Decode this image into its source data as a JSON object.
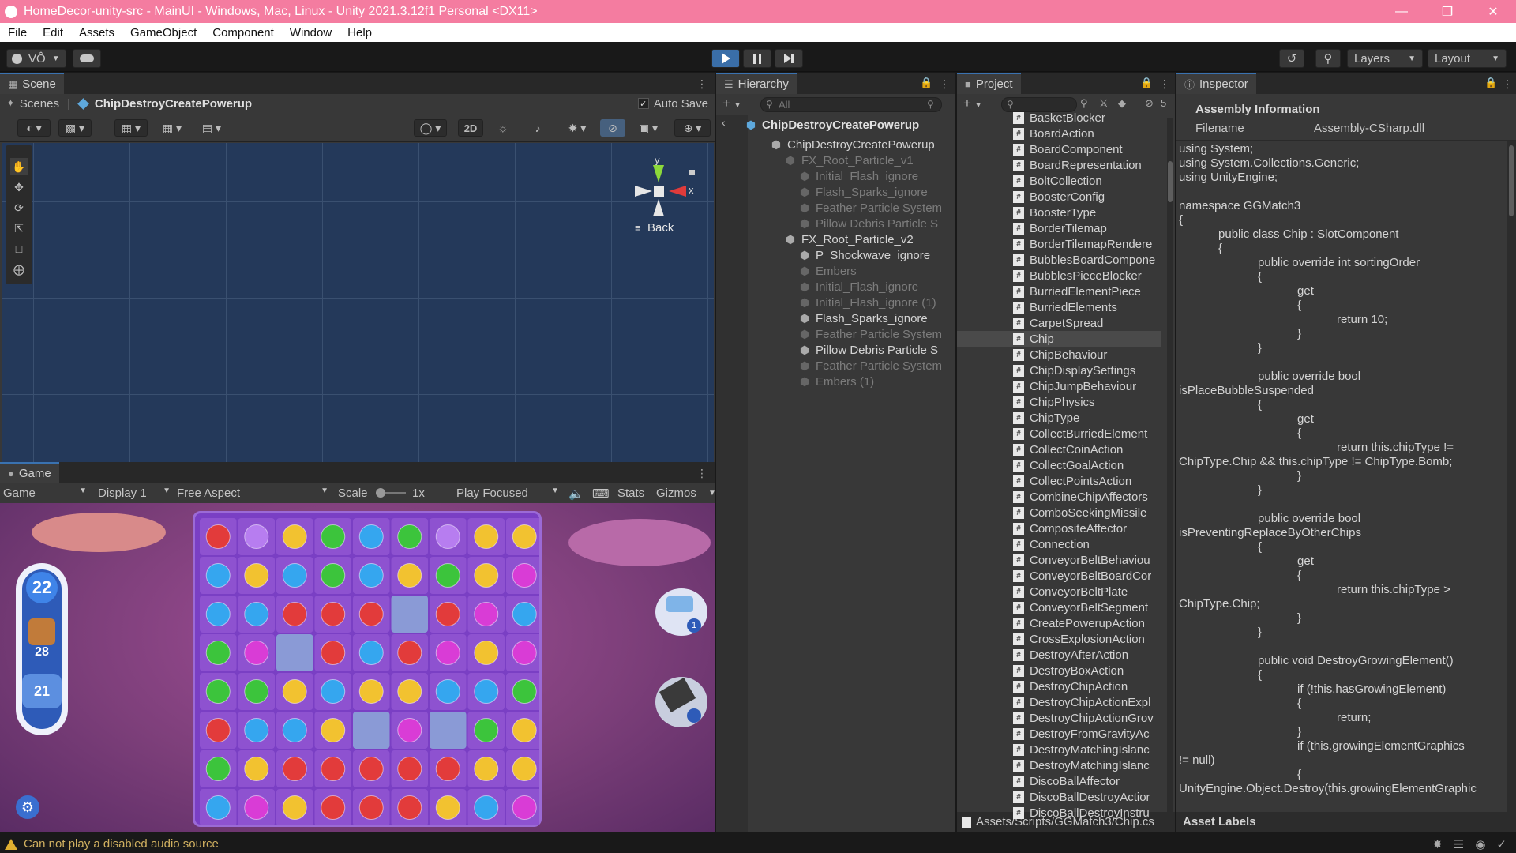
{
  "window": {
    "title": "HomeDecor-unity-src - MainUI - Windows, Mac, Linux - Unity 2021.3.12f1 Personal <DX11>"
  },
  "menu": [
    "File",
    "Edit",
    "Assets",
    "GameObject",
    "Component",
    "Window",
    "Help"
  ],
  "toolbar": {
    "account_label": "VÔ",
    "layers_label": "Layers",
    "layout_label": "Layout"
  },
  "scene": {
    "tab_label": "Scene",
    "breadcrumb_root": "Scenes",
    "breadcrumb_prefab": "ChipDestroyCreatePowerup",
    "auto_save_label": "Auto Save",
    "auto_save_checked": true,
    "mode_2d": "2D",
    "gizmo_y": "y",
    "gizmo_x": "x",
    "gizmo_back": "Back"
  },
  "game": {
    "tab_label": "Game",
    "mode": "Game",
    "display": "Display 1",
    "aspect": "Free Aspect",
    "scale_label": "Scale",
    "scale_value": "1x",
    "play_mode": "Play Focused",
    "stats_label": "Stats",
    "gizmos_label": "Gizmos",
    "moves_value": "22",
    "goal_count": "28",
    "score_value": "21",
    "booster_badge_1": "1",
    "colors": {
      "background": "#7d3f7a",
      "board": "#7a3fc4",
      "panel": "#2e5bb8"
    }
  },
  "hierarchy": {
    "tab_label": "Hierarchy",
    "search_placeholder": "All",
    "root": "ChipDestroyCreatePowerup",
    "items": [
      {
        "label": "ChipDestroyCreatePowerup",
        "level": 1,
        "active": true,
        "expanded": true
      },
      {
        "label": "FX_Root_Particle_v1",
        "level": 2,
        "active": false,
        "expanded": true
      },
      {
        "label": "Initial_Flash_ignore",
        "level": 3,
        "active": false
      },
      {
        "label": "Flash_Sparks_ignore",
        "level": 3,
        "active": false
      },
      {
        "label": "Feather Particle System",
        "level": 3,
        "active": false
      },
      {
        "label": "Pillow Debris Particle S",
        "level": 3,
        "active": false
      },
      {
        "label": "FX_Root_Particle_v2",
        "level": 2,
        "active": true,
        "expanded": true
      },
      {
        "label": "P_Shockwave_ignore",
        "level": 3,
        "active": true
      },
      {
        "label": "Embers",
        "level": 3,
        "active": false
      },
      {
        "label": "Initial_Flash_ignore",
        "level": 3,
        "active": false
      },
      {
        "label": "Initial_Flash_ignore (1)",
        "level": 3,
        "active": false
      },
      {
        "label": "Flash_Sparks_ignore",
        "level": 3,
        "active": true
      },
      {
        "label": "Feather Particle System",
        "level": 3,
        "active": false
      },
      {
        "label": "Pillow Debris Particle S",
        "level": 3,
        "active": true
      },
      {
        "label": "Feather Particle System",
        "level": 3,
        "active": false
      },
      {
        "label": "Embers (1)",
        "level": 3,
        "active": false
      }
    ]
  },
  "project": {
    "tab_label": "Project",
    "hidden_count": "5",
    "path": "Assets/Scripts/GGMatch3/Chip.cs",
    "selected": "Chip",
    "items": [
      "BasketBlocker",
      "BoardAction",
      "BoardComponent",
      "BoardRepresentation",
      "BoltCollection",
      "BoosterConfig",
      "BoosterType",
      "BorderTilemap",
      "BorderTilemapRendere",
      "BubblesBoardCompone",
      "BubblesPieceBlocker",
      "BurriedElementPiece",
      "BurriedElements",
      "CarpetSpread",
      "Chip",
      "ChipBehaviour",
      "ChipDisplaySettings",
      "ChipJumpBehaviour",
      "ChipPhysics",
      "ChipType",
      "CollectBurriedElement",
      "CollectCoinAction",
      "CollectGoalAction",
      "CollectPointsAction",
      "CombineChipAffectors",
      "ComboSeekingMissile",
      "CompositeAffector",
      "Connection",
      "ConveyorBeltBehaviou",
      "ConveyorBeltBoardCor",
      "ConveyorBeltPlate",
      "ConveyorBeltSegment",
      "CreatePowerupAction",
      "CrossExplosionAction",
      "DestroyAfterAction",
      "DestroyBoxAction",
      "DestroyChipAction",
      "DestroyChipActionExpl",
      "DestroyChipActionGrov",
      "DestroyFromGravityAc",
      "DestroyMatchingIslanc",
      "DestroyMatchingIslanc",
      "DiscoBallAffector",
      "DiscoBallDestroyActior",
      "DiscoBallDestroyInstru"
    ]
  },
  "inspector": {
    "tab_label": "Inspector",
    "section_title": "Assembly Information",
    "filename_label": "Filename",
    "filename_value": "Assembly-CSharp.dll",
    "asset_labels": "Asset Labels",
    "code_lines": [
      "using System;",
      "using System.Collections.Generic;",
      "using UnityEngine;",
      "",
      "namespace GGMatch3",
      "{",
      "            public class Chip : SlotComponent",
      "            {",
      "                        public override int sortingOrder",
      "                        {",
      "                                    get",
      "                                    {",
      "                                                return 10;",
      "                                    }",
      "                        }",
      "",
      "                        public override bool",
      "isPlaceBubbleSuspended",
      "                        {",
      "                                    get",
      "                                    {",
      "                                                return this.chipType !=",
      "ChipType.Chip && this.chipType != ChipType.Bomb;",
      "                                    }",
      "                        }",
      "",
      "                        public override bool",
      "isPreventingReplaceByOtherChips",
      "                        {",
      "                                    get",
      "                                    {",
      "                                                return this.chipType >",
      "ChipType.Chip;",
      "                                    }",
      "                        }",
      "",
      "                        public void DestroyGrowingElement()",
      "                        {",
      "                                    if (!this.hasGrowingElement)",
      "                                    {",
      "                                                return;",
      "                                    }",
      "                                    if (this.growingElementGraphics",
      "!= null)",
      "                                    {",
      "UnityEngine.Object.Destroy(this.growingElementGraphic"
    ]
  },
  "status": {
    "message": "Can not play a disabled audio source"
  }
}
